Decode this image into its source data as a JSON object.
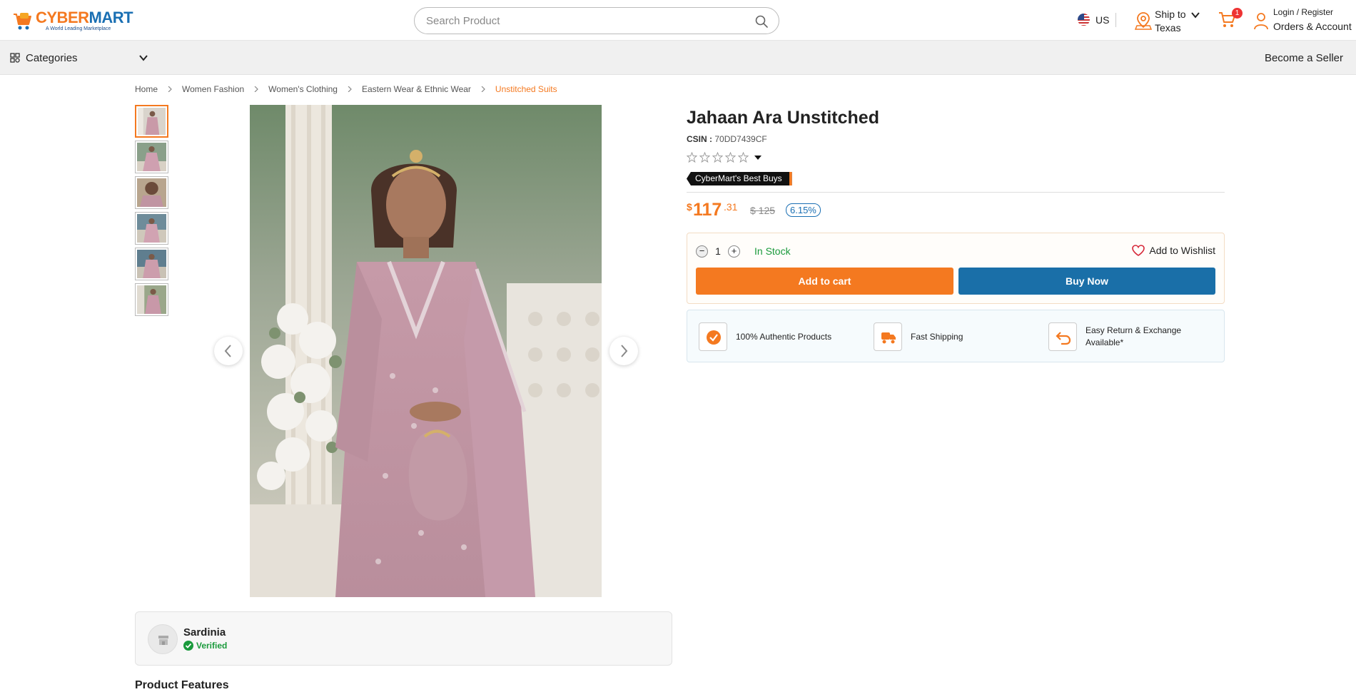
{
  "brand": {
    "name_left": "CYBER",
    "name_right": "MART",
    "tagline": "A World Leading Marketplace"
  },
  "search": {
    "placeholder": "Search Product"
  },
  "country": {
    "code": "US"
  },
  "ship": {
    "label": "Ship to",
    "value": "Texas"
  },
  "cart": {
    "count": "1"
  },
  "account": {
    "login": "Login / Register",
    "orders": "Orders & Account"
  },
  "nav": {
    "categories": "Categories",
    "become_seller": "Become a Seller"
  },
  "breadcrumb": [
    "Home",
    "Women Fashion",
    "Women's Clothing",
    "Eastern Wear & Ethnic Wear",
    "Unstitched Suits"
  ],
  "product": {
    "title": "Jahaan Ara Unstitched",
    "csin_label": "CSIN :",
    "csin": "70DD7439CF",
    "rating_stars": 0,
    "badge": "CyberMart's Best Buys",
    "price_currency": "$",
    "price_whole": "117",
    "price_fraction": ".31",
    "old_price": "$ 125",
    "discount": "6.15%",
    "quantity": "1",
    "stock": "In Stock",
    "wishlist": "Add to Wishlist",
    "add_to_cart": "Add to cart",
    "buy_now": "Buy Now"
  },
  "trust": [
    "100% Authentic Products",
    "Fast Shipping",
    "Easy Return & Exchange Available*"
  ],
  "seller": {
    "name": "Sardinia",
    "status": "Verified"
  },
  "features_heading": "Product Features",
  "colors": {
    "accent": "#f47920",
    "primary": "#1a6fb3",
    "success": "#1a9a3c",
    "product": "#c99aa8"
  }
}
